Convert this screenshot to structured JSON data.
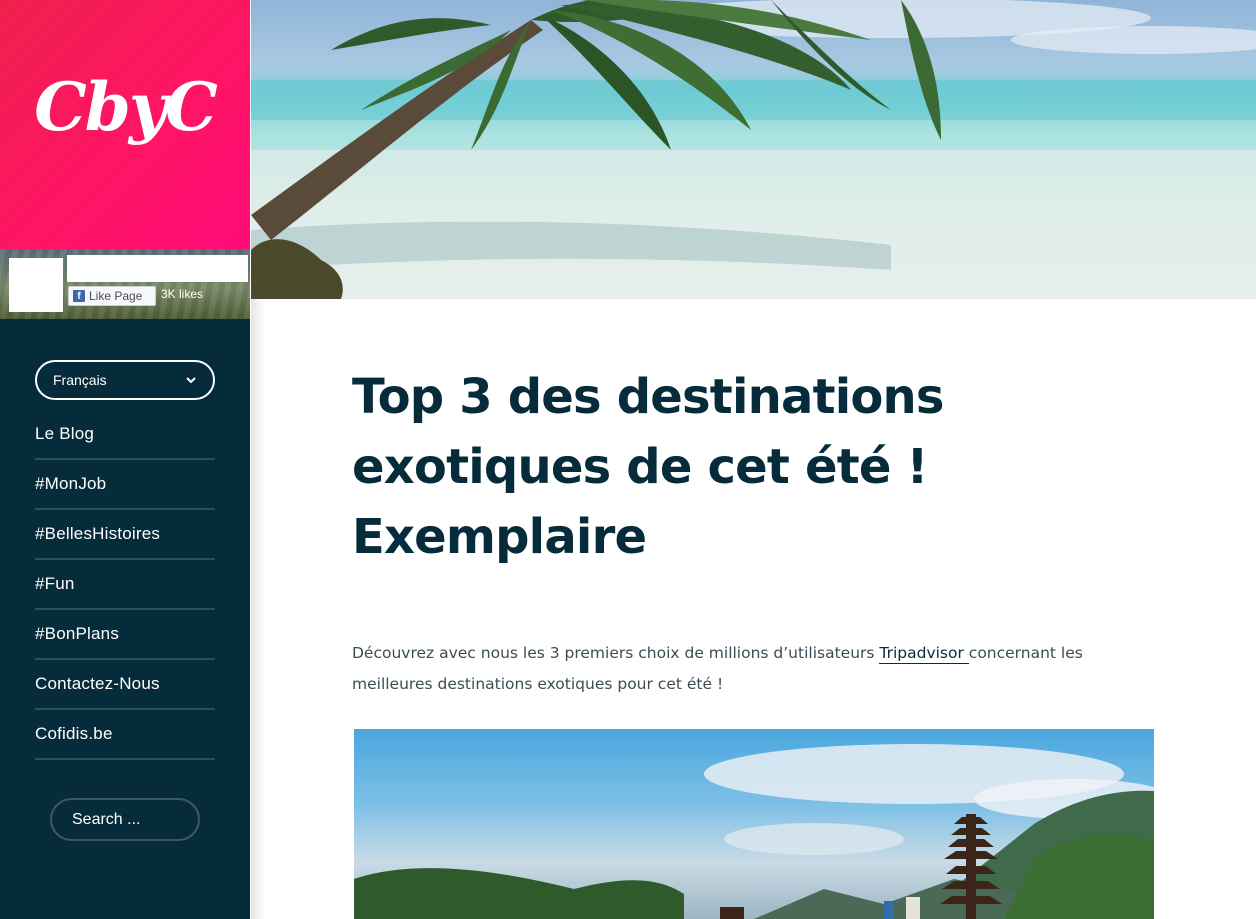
{
  "brand": {
    "logo_text": "CbyC"
  },
  "facebook_widget": {
    "like_label": "Like Page",
    "likes_count": "3K likes"
  },
  "sidebar": {
    "language": {
      "selected": "Français"
    },
    "nav": [
      {
        "label": "Le Blog"
      },
      {
        "label": "#MonJob"
      },
      {
        "label": "#BellesHistoires"
      },
      {
        "label": "#Fun"
      },
      {
        "label": "#BonPlans"
      },
      {
        "label": "Contactez-Nous"
      },
      {
        "label": "Cofidis.be"
      }
    ],
    "search": {
      "placeholder": "Search ..."
    }
  },
  "article": {
    "title_line1": "Top 3 des destinations",
    "title_line2": "exotiques de cet été !",
    "title_line3": "Exemplaire",
    "intro_before": "Découvrez avec nous les 3 premiers choix de millions d’utilisateurs ",
    "intro_link": "Tripadvisor ",
    "intro_after": " concernant les meilleures destinations exotiques pour cet été !"
  },
  "colors": {
    "brand_pink": "#ff0a6c",
    "sidebar_bg": "#062b3a",
    "title_color": "#062b3a"
  }
}
